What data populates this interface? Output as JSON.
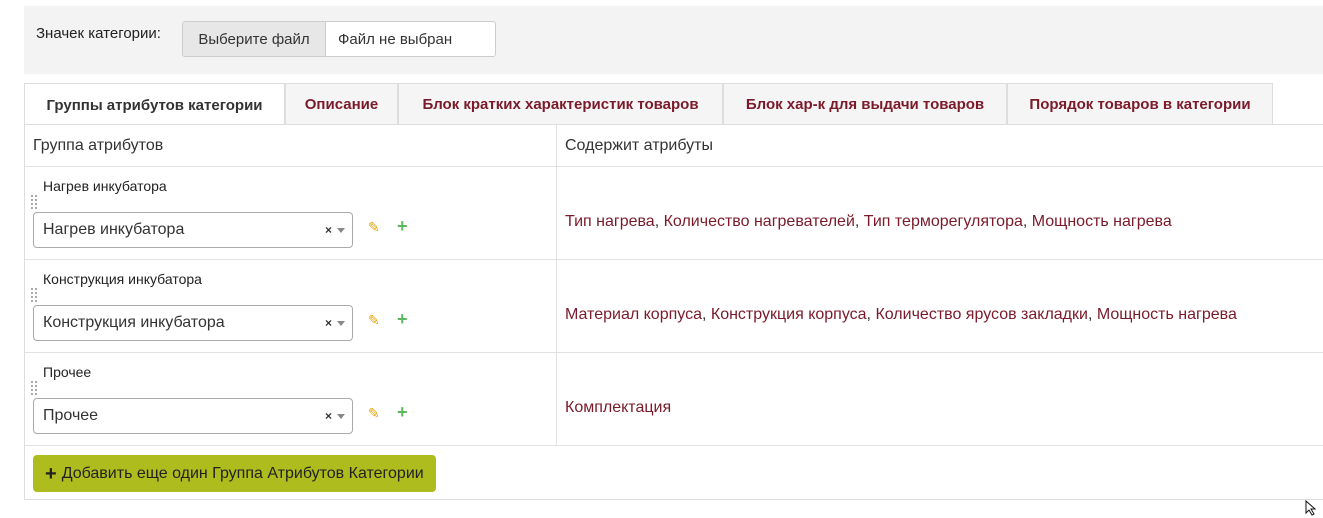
{
  "category_icon": {
    "label": "Значек категории:",
    "choose_file_button": "Выберите файл",
    "file_status": "Файл не выбран"
  },
  "tabs": [
    {
      "label": "Группы атрибутов категории",
      "active": true
    },
    {
      "label": "Описание",
      "active": false
    },
    {
      "label": "Блок кратких характеристик товаров",
      "active": false
    },
    {
      "label": "Блок хар-к для выдачи товаров",
      "active": false
    },
    {
      "label": "Порядок товаров в категории",
      "active": false
    }
  ],
  "table": {
    "headers": [
      "Группа атрибутов",
      "Содержит атрибуты"
    ],
    "rows": [
      {
        "label": "Нагрев инкубатора",
        "selected": "Нагрев инкубатора",
        "attributes": [
          "Тип нагрева",
          "Количество нагревателей",
          "Тип терморегулятора",
          "Мощность нагрева"
        ]
      },
      {
        "label": "Конструкция инкубатора",
        "selected": "Конструкция инкубатора",
        "attributes": [
          "Материал корпуса",
          "Конструкция корпуса",
          "Количество ярусов закладки",
          "Мощность нагрева"
        ]
      },
      {
        "label": "Прочее",
        "selected": "Прочее",
        "attributes": [
          "Комплектация"
        ]
      }
    ],
    "clear_glyph": "×",
    "add_button": "Добавить еще один Группа Атрибутов Категории"
  },
  "icons": {
    "edit": "pencil-icon",
    "add": "plus-icon",
    "drag": "drag-handle-icon",
    "dropdown": "chevron-down-icon",
    "cursor": "mouse-cursor-icon"
  },
  "colors": {
    "tab_link": "#7a1a2a",
    "attribute_link": "#7a1a2a",
    "add_button_bg": "#aebc1e",
    "pencil": "#e8a40c",
    "plus": "#5cb85c"
  }
}
